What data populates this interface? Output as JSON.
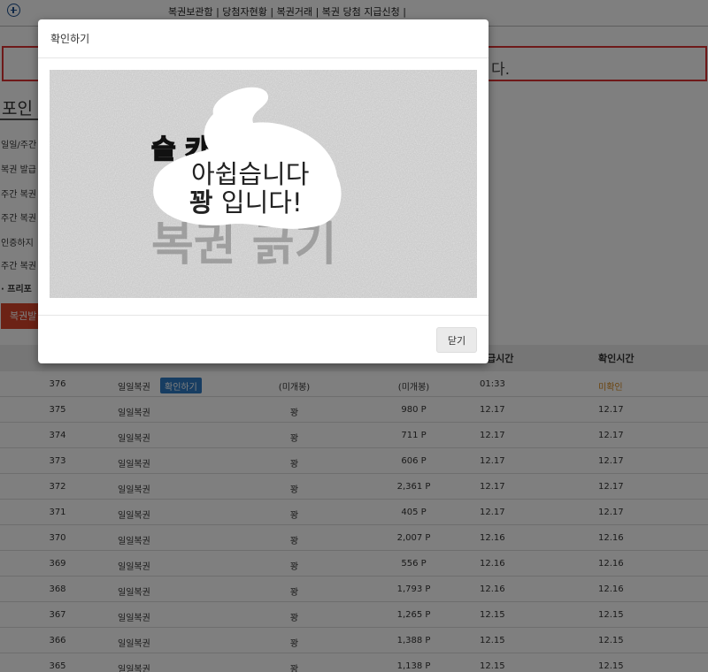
{
  "topnav": {
    "links": "복권보관함 | 당첨자현황 | 복권거래 | 복권 당첨 지급신청 |"
  },
  "notice": {
    "text_fragment": "다."
  },
  "page_title": "포인",
  "info_rows": [
    "일일/주간",
    "복권 발급",
    "주간 복권",
    "주간 복권",
    "인증하지",
    "주간 복권",
    "· 프리포"
  ],
  "red_button": "복권발",
  "table": {
    "headers": {
      "time1": "급시간",
      "time2": "확인시간"
    },
    "confirm_label": "확인하기",
    "rows": [
      {
        "no": "376",
        "type": "일일복권",
        "result": "(미개봉)",
        "point": "(미개봉)",
        "time1": "01:33",
        "time2": "미확인",
        "has_button": true,
        "unconfirmed": true
      },
      {
        "no": "375",
        "type": "일일복권",
        "result": "꽝",
        "point": "980 P",
        "time1": "12.17",
        "time2": "12.17"
      },
      {
        "no": "374",
        "type": "일일복권",
        "result": "꽝",
        "point": "711 P",
        "time1": "12.17",
        "time2": "12.17"
      },
      {
        "no": "373",
        "type": "일일복권",
        "result": "꽝",
        "point": "606 P",
        "time1": "12.17",
        "time2": "12.17"
      },
      {
        "no": "372",
        "type": "일일복권",
        "result": "꽝",
        "point": "2,361 P",
        "time1": "12.17",
        "time2": "12.17"
      },
      {
        "no": "371",
        "type": "일일복권",
        "result": "꽝",
        "point": "405 P",
        "time1": "12.17",
        "time2": "12.17"
      },
      {
        "no": "370",
        "type": "일일복권",
        "result": "꽝",
        "point": "2,007 P",
        "time1": "12.16",
        "time2": "12.16"
      },
      {
        "no": "369",
        "type": "일일복권",
        "result": "꽝",
        "point": "556 P",
        "time1": "12.16",
        "time2": "12.16"
      },
      {
        "no": "368",
        "type": "일일복권",
        "result": "꽝",
        "point": "1,793 P",
        "time1": "12.16",
        "time2": "12.16"
      },
      {
        "no": "367",
        "type": "일일복권",
        "result": "꽝",
        "point": "1,265 P",
        "time1": "12.15",
        "time2": "12.15"
      },
      {
        "no": "366",
        "type": "일일복권",
        "result": "꽝",
        "point": "1,388 P",
        "time1": "12.15",
        "time2": "12.15"
      },
      {
        "no": "365",
        "type": "일일복권",
        "result": "꽝",
        "point": "1,138 P",
        "time1": "12.15",
        "time2": "12.15"
      }
    ]
  },
  "modal": {
    "title": "확인하기",
    "scratch": {
      "brand": "슬     카지노",
      "watermark": "복권 긁기",
      "line1": "아쉽습니다",
      "line2_bold": "꽝",
      "line2_rest": " 입니다!"
    },
    "close_label": "닫기"
  },
  "colors": {
    "accent_blue": "#2e7bc4",
    "brand_red": "#d9452a",
    "unconfirmed": "#d7891d",
    "notice_border": "#dd3333"
  }
}
